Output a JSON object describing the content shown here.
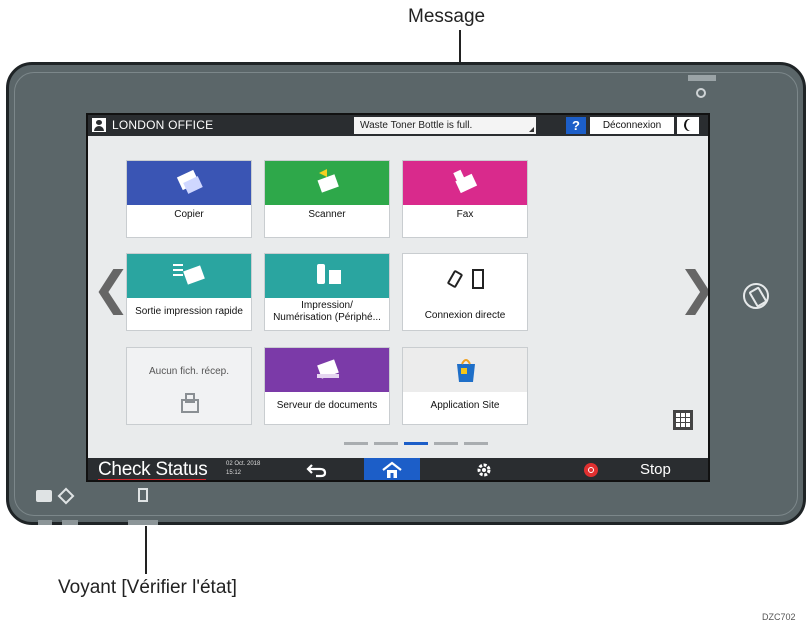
{
  "callouts": {
    "message": "Message",
    "status_light": "Voyant [Vérifier l'état]",
    "figure_code": "DZC702"
  },
  "topbar": {
    "user_name": "LONDON OFFICE",
    "message_text": "Waste Toner Bottle is full.",
    "help_label": "?",
    "logout_label": "Déconnexion"
  },
  "apps": [
    {
      "label": "Copier",
      "color": "#3a55b4",
      "icon": "copier-icon"
    },
    {
      "label": "Scanner",
      "color": "#2ea84a",
      "icon": "scanner-icon"
    },
    {
      "label": "Fax",
      "color": "#d92a8c",
      "icon": "fax-icon"
    },
    {
      "label": "Sortie impression rapide",
      "color": "#2aa5a0",
      "icon": "quick-print-icon"
    },
    {
      "label": "Impression/ Numérisation (Périphé...",
      "color": "#2aa5a0",
      "icon": "usb-memory-icon"
    },
    {
      "label": "Connexion directe",
      "color": "#ffffff",
      "icon": "direct-connect-icon"
    },
    {
      "label": "Aucun fich. récep.",
      "color": "#f1f2f3",
      "icon": "fax-box-icon"
    },
    {
      "label": "Serveur de documents",
      "color": "#7b3aa8",
      "icon": "document-server-icon"
    },
    {
      "label": "Application Site",
      "color": "#ececec",
      "icon": "shopping-bag-icon"
    }
  ],
  "bottombar": {
    "check_status": "Check Status",
    "date": "02 Oct. 2018",
    "time": "15:12",
    "stop_label": "Stop"
  },
  "colors": {
    "accent_blue": "#1c5ec8",
    "stop_red": "#e03030",
    "bezel": "#5b6669"
  }
}
